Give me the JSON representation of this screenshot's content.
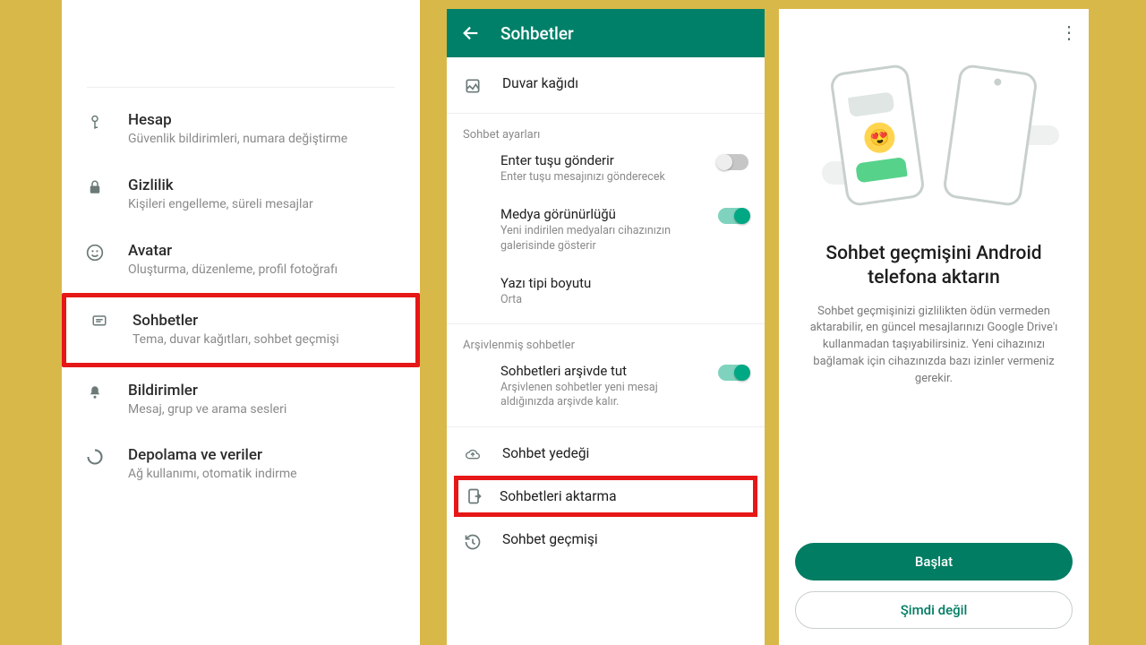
{
  "panel1": {
    "items": [
      {
        "title": "Hesap",
        "sub": "Güvenlik bildirimleri, numara değiştirme"
      },
      {
        "title": "Gizlilik",
        "sub": "Kişileri engelleme, süreli mesajlar"
      },
      {
        "title": "Avatar",
        "sub": "Oluşturma, düzenleme, profil fotoğrafı"
      },
      {
        "title": "Sohbetler",
        "sub": "Tema, duvar kağıtları, sohbet geçmişi"
      },
      {
        "title": "Bildirimler",
        "sub": "Mesaj, grup ve arama sesleri"
      },
      {
        "title": "Depolama ve veriler",
        "sub": "Ağ kullanımı, otomatik indirme"
      }
    ]
  },
  "panel2": {
    "title": "Sohbetler",
    "wallpaper": "Duvar kağıdı",
    "section_chat": "Sohbet ayarları",
    "enter": {
      "title": "Enter tuşu gönderir",
      "sub": "Enter tuşu mesajınızı gönderecek"
    },
    "media": {
      "title": "Medya görünürlüğü",
      "sub": "Yeni indirilen medyaları cihazınızın galerisinde gösterir"
    },
    "font": {
      "title": "Yazı tipi boyutu",
      "sub": "Orta"
    },
    "section_archive": "Arşivlenmiş sohbetler",
    "archive": {
      "title": "Sohbetleri arşivde tut",
      "sub": "Arşivlenen sohbetler yeni mesaj aldığınızda arşivde kalır."
    },
    "backup": "Sohbet yedeği",
    "transfer": "Sohbetleri aktarma",
    "history": "Sohbet geçmişi"
  },
  "panel3": {
    "heading": "Sohbet geçmişini Android telefona aktarın",
    "desc": "Sohbet geçmişinizi gizlilikten ödün vermeden aktarabilir, en güncel mesajlarınızı Google Drive'ı kullanmadan taşıyabilirsiniz. Yeni cihazınızı bağlamak için cihazınızda bazı izinler vermeniz gerekir.",
    "start": "Başlat",
    "not_now": "Şimdi değil"
  }
}
